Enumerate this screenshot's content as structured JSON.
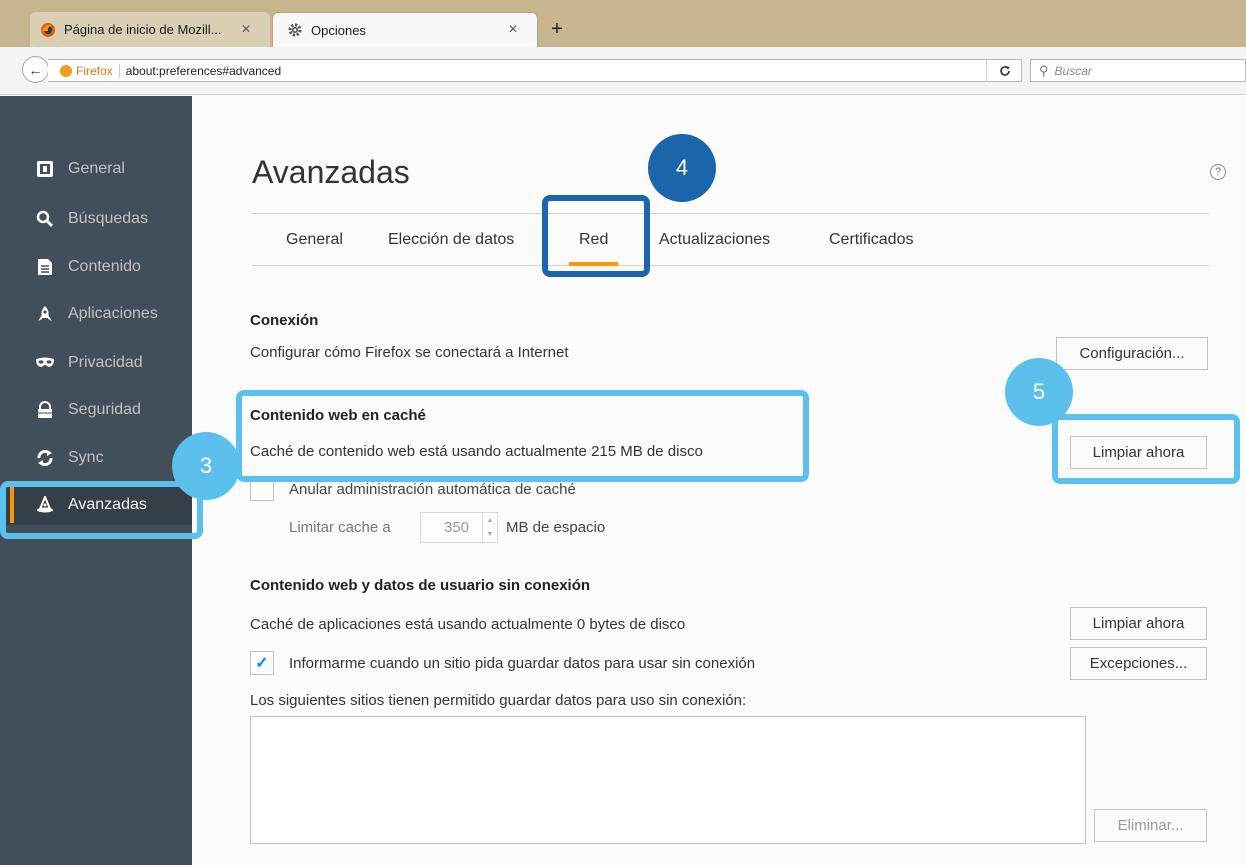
{
  "browser": {
    "tabs": [
      {
        "title": "Página de inicio de Mozill...",
        "favicon": "firefox-icon",
        "close": "×"
      },
      {
        "title": "Opciones",
        "favicon": "gear-icon",
        "close": "×"
      }
    ],
    "new_tab": "+",
    "url_identity": "Firefox",
    "url": "about:preferences#advanced",
    "reload": "C",
    "search_placeholder": "Buscar"
  },
  "sidebar": {
    "items": [
      {
        "label": "General",
        "icon": "general-icon"
      },
      {
        "label": "Búsquedas",
        "icon": "search-icon"
      },
      {
        "label": "Contenido",
        "icon": "document-icon"
      },
      {
        "label": "Aplicaciones",
        "icon": "rocket-icon"
      },
      {
        "label": "Privacidad",
        "icon": "mask-icon"
      },
      {
        "label": "Seguridad",
        "icon": "lock-icon"
      },
      {
        "label": "Sync",
        "icon": "sync-icon"
      },
      {
        "label": "Avanzadas",
        "icon": "wizard-hat-icon",
        "selected": true
      }
    ]
  },
  "main": {
    "title": "Avanzadas",
    "help": "?",
    "tabs": [
      {
        "label": "General"
      },
      {
        "label": "Elección de datos"
      },
      {
        "label": "Red",
        "active": true
      },
      {
        "label": "Actualizaciones"
      },
      {
        "label": "Certificados"
      }
    ],
    "connection": {
      "title": "Conexión",
      "desc": "Configurar cómo Firefox se conectará a Internet",
      "button": "Configuración..."
    },
    "cache": {
      "title": "Contenido web en caché",
      "desc": "Caché de contenido web está usando actualmente 215 MB de disco",
      "button": "Limpiar ahora",
      "override_label": "Anular administración automática de caché",
      "override_checked": false,
      "limit_label": "Limitar cache a",
      "limit_value": "350",
      "limit_unit": "MB de espacio"
    },
    "offline": {
      "title": "Contenido web y datos de usuario sin conexión",
      "desc": "Caché de aplicaciones está usando actualmente 0 bytes de disco",
      "clear_button": "Limpiar ahora",
      "notify_label": "Informarme cuando un sitio pida guardar datos para usar sin conexión",
      "notify_checked": true,
      "exceptions_button": "Excepciones...",
      "list_label": "Los siguientes sitios tienen permitido guardar datos para uso sin conexión:",
      "remove_button": "Eliminar..."
    }
  },
  "annotations": {
    "badges": [
      "3",
      "4",
      "5"
    ],
    "colors": {
      "light": "#5bc0eb",
      "dark": "#1b65ad",
      "accent": "#ff9500"
    }
  }
}
